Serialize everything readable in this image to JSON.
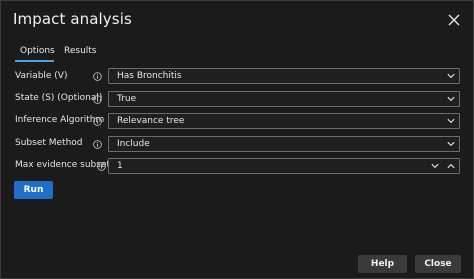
{
  "dialog": {
    "title": "Impact analysis",
    "close_icon": "close-icon"
  },
  "tabs": [
    {
      "label": "Options",
      "active": true
    },
    {
      "label": "Results",
      "active": false
    }
  ],
  "form": {
    "rows": [
      {
        "label": "Variable (V)",
        "value": "Has Bronchitis",
        "control": "dropdown"
      },
      {
        "label": "State (S) (Optional)",
        "value": "True",
        "control": "dropdown"
      },
      {
        "label": "Inference Algorithm",
        "value": "Relevance tree",
        "control": "dropdown"
      },
      {
        "label": "Subset Method",
        "value": "Include",
        "control": "dropdown"
      },
      {
        "label": "Max evidence subset",
        "value": "1",
        "control": "stepper"
      }
    ],
    "info_icon": "info-circle-icon"
  },
  "actions": {
    "run_label": "Run",
    "help_label": "Help",
    "close_label": "Close"
  },
  "colors": {
    "background": "#1b1b1b",
    "accent": "#1f6fc9",
    "tab_underline": "#4aa3e8",
    "field_border": "#6b6b6b",
    "secondary_button": "#3a3a3a"
  }
}
